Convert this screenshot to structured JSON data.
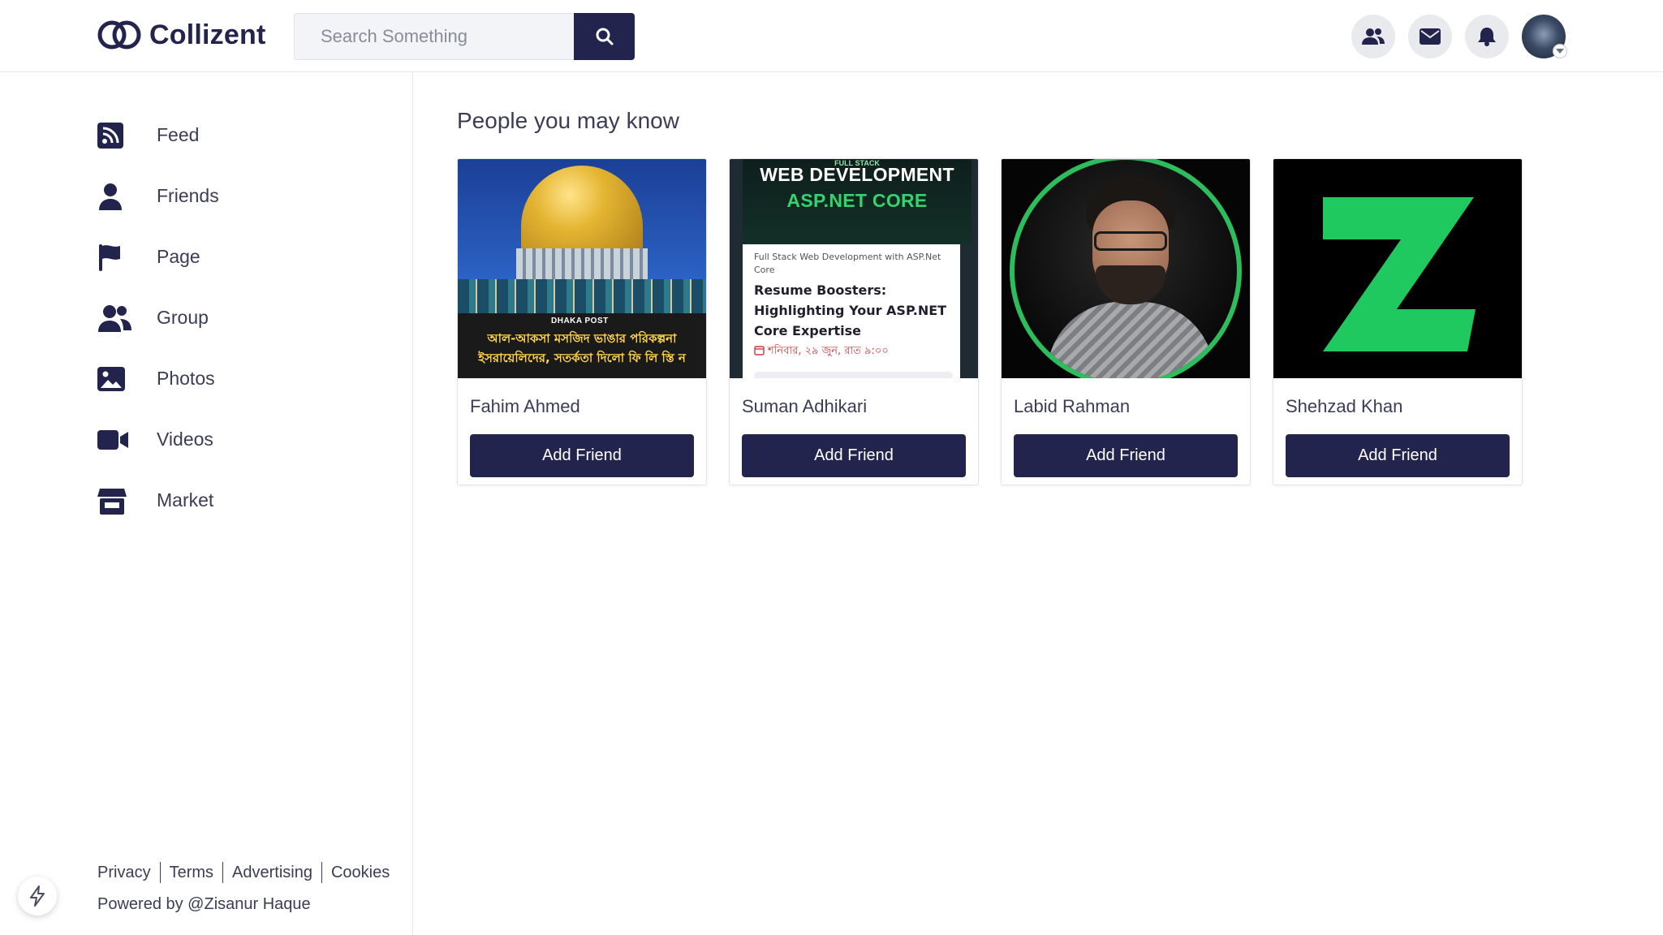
{
  "app": {
    "name": "Collizent"
  },
  "search": {
    "placeholder": "Search Something",
    "value": ""
  },
  "header": {
    "icons": [
      "friends-icon",
      "mail-icon",
      "bell-icon"
    ]
  },
  "sidebar": {
    "items": [
      {
        "label": "Feed",
        "icon": "rss-icon"
      },
      {
        "label": "Friends",
        "icon": "user-icon"
      },
      {
        "label": "Page",
        "icon": "flag-icon"
      },
      {
        "label": "Group",
        "icon": "group-icon"
      },
      {
        "label": "Photos",
        "icon": "image-icon"
      },
      {
        "label": "Videos",
        "icon": "video-icon"
      },
      {
        "label": "Market",
        "icon": "store-icon"
      }
    ],
    "footer_links": [
      "Privacy",
      "Terms",
      "Advertising",
      "Cookies"
    ],
    "powered_by": "Powered by @Zisanur Haque"
  },
  "main": {
    "section_title": "People you may know",
    "people": [
      {
        "name": "Fahim Ahmed",
        "button": "Add Friend",
        "image": {
          "brand": "DHAKA POST",
          "line1": "আল-আকসা মসজিদ ভাঙার পরিকল্পনা",
          "line2": "ইসরায়েলিদের, সতর্কতা দিলো ফি লি স্তি ন"
        }
      },
      {
        "name": "Suman Adhikari",
        "button": "Add Friend",
        "image": {
          "kicker": "FULL STACK",
          "title_line1": "WEB DEVELOPMENT",
          "title_line2": "ASP.NET CORE",
          "meta": "Full Stack Web Development with ASP.Net Core",
          "post_title": "Resume Boosters: Highlighting Your ASP.NET Core Expertise",
          "date": "শনিবার, ২৯ জুন, রাত ৯:০০"
        }
      },
      {
        "name": "Labid Rahman",
        "button": "Add Friend"
      },
      {
        "name": "Shehzad Khan",
        "button": "Add Friend"
      }
    ]
  },
  "colors": {
    "primary": "#23244d",
    "ring_green": "#2ebd5c",
    "logo_green": "#1fc95f"
  }
}
